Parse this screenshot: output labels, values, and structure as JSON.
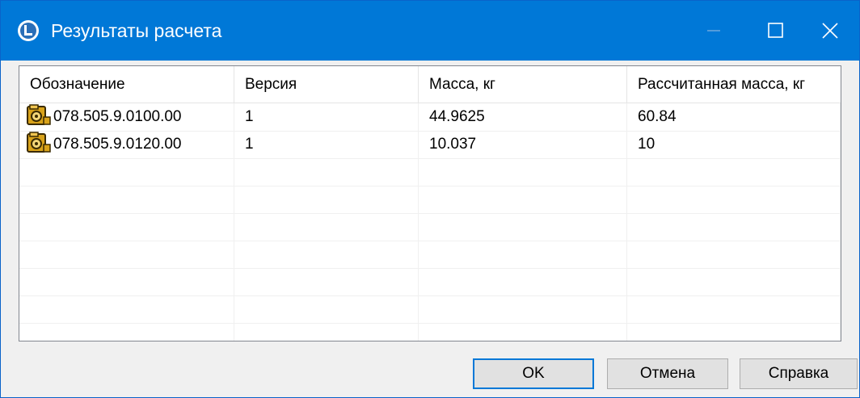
{
  "window": {
    "title": "Результаты расчета",
    "accent_color": "#0078d7",
    "title_icon": "app-logo-icon",
    "controls": {
      "minimize_icon": "minimize-icon",
      "maximize_icon": "maximize-icon",
      "close_icon": "close-icon"
    }
  },
  "table": {
    "columns": [
      "Обозначение",
      "Версия",
      "Масса, кг",
      "Рассчитанная масса, кг"
    ],
    "rows": [
      {
        "icon": "assembly-icon",
        "designation": "078.505.9.0100.00",
        "version": "1",
        "mass": "44.9625",
        "calculated_mass": "60.84"
      },
      {
        "icon": "assembly-icon",
        "designation": "078.505.9.0120.00",
        "version": "1",
        "mass": "10.037",
        "calculated_mass": "10"
      }
    ]
  },
  "buttons": {
    "ok": "OK",
    "cancel": "Отмена",
    "help": "Справка"
  }
}
